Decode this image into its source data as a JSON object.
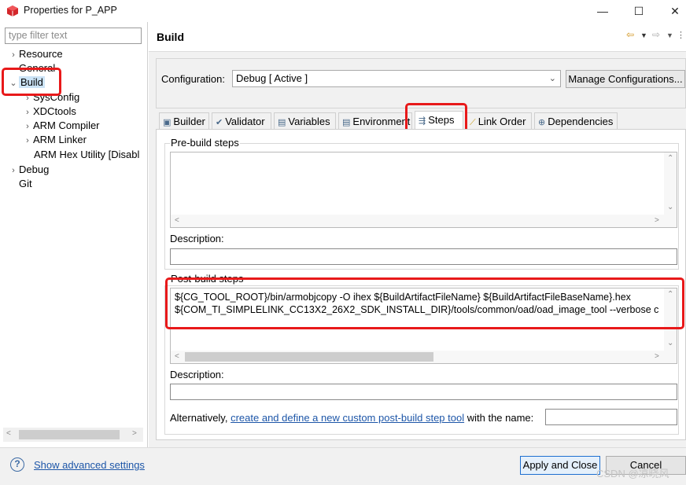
{
  "window": {
    "title": "Properties for P_APP",
    "minimize_glyph": "—",
    "maximize_glyph": "☐",
    "close_glyph": "✕"
  },
  "sidebar": {
    "filter_placeholder": "type filter text",
    "items": [
      {
        "label": "Resource",
        "expander": "›"
      },
      {
        "label": "General",
        "expander": ""
      },
      {
        "label": "Build",
        "expander": "⌄"
      },
      {
        "label": "SysConfig",
        "expander": "›"
      },
      {
        "label": "XDCtools",
        "expander": "›"
      },
      {
        "label": "ARM Compiler",
        "expander": "›"
      },
      {
        "label": "ARM Linker",
        "expander": "›"
      },
      {
        "label": "ARM Hex Utility  [Disabl",
        "expander": ""
      },
      {
        "label": "Debug",
        "expander": "›"
      },
      {
        "label": "Git",
        "expander": ""
      }
    ]
  },
  "header": {
    "title": "Build"
  },
  "configuration": {
    "label": "Configuration:",
    "value": "Debug  [ Active ]",
    "manage_button": "Manage Configurations..."
  },
  "tabs": [
    {
      "label": "Builder",
      "icon": "builder-icon",
      "glyph": "▣"
    },
    {
      "label": "Validator",
      "icon": "validator-icon",
      "glyph": "✔"
    },
    {
      "label": "Variables",
      "icon": "variables-icon",
      "glyph": "▤"
    },
    {
      "label": "Environment",
      "icon": "environment-icon",
      "glyph": "▤"
    },
    {
      "label": "Steps",
      "icon": "steps-icon",
      "glyph": "⇶"
    },
    {
      "label": "Link Order",
      "icon": "link-order-icon",
      "glyph": "⟋"
    },
    {
      "label": "Dependencies",
      "icon": "dependencies-icon",
      "glyph": "⊕"
    }
  ],
  "active_tab": "Steps",
  "pre_build": {
    "legend": "Pre-build steps",
    "commands": "",
    "description_label": "Description:",
    "description_value": ""
  },
  "post_build": {
    "legend": "Post-build steps",
    "commands": [
      "${CG_TOOL_ROOT}/bin/armobjcopy -O ihex  ${BuildArtifactFileName} ${BuildArtifactFileBaseName}.hex",
      "${COM_TI_SIMPLELINK_CC13X2_26X2_SDK_INSTALL_DIR}/tools/common/oad/oad_image_tool  --verbose c"
    ],
    "description_label": "Description:",
    "description_value": ""
  },
  "alternatively": {
    "prefix": "Alternatively,",
    "link": "create and define a new custom post-build step tool",
    "suffix": "with the name:",
    "name_value": ""
  },
  "footer": {
    "advanced_link": "Show advanced settings",
    "apply_close": "Apply and Close",
    "cancel": "Cancel"
  },
  "watermark": "CSDN @凉晓风",
  "colors": {
    "highlight": "#e8191a",
    "link": "#1d56a8"
  }
}
